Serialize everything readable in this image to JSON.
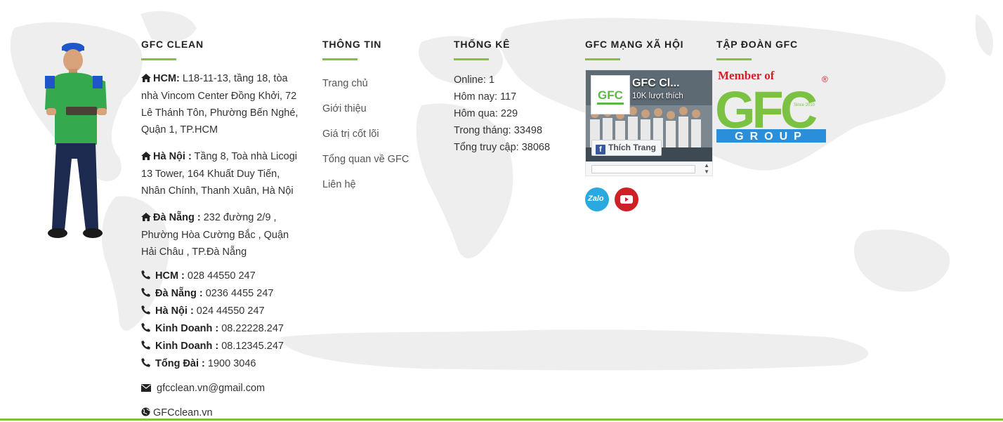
{
  "colors": {
    "accent": "#7fc241",
    "title": "#222222",
    "text": "#333333",
    "link": "#555555",
    "zalo": "#29a9e0",
    "youtube": "#cf2027"
  },
  "col1": {
    "title": "GFC CLEAN",
    "addresses": [
      {
        "icon": "home-icon",
        "label": "HCM:",
        "text": " L18-11-13, tầng 18, tòa nhà Vincom Center Đồng Khởi, 72 Lê Thánh Tôn, Phường Bến Nghé, Quận 1, TP.HCM"
      },
      {
        "icon": "home-icon",
        "label": "Hà Nội :",
        "text": " Tầng 8, Toà nhà Licogi 13 Tower, 164 Khuất Duy Tiến, Nhân Chính, Thanh Xuân, Hà Nội"
      },
      {
        "icon": "home-icon",
        "label": "Đà Nẵng :",
        "text": " 232 đường 2/9 , Phường Hòa Cường Bắc , Quận Hải Châu , TP.Đà Nẵng"
      }
    ],
    "phones": [
      {
        "icon": "phone-icon",
        "label": "HCM :",
        "value": " 028 44550 247"
      },
      {
        "icon": "phone-icon",
        "label": "Đà Nẵng :",
        "value": " 0236 4455 247"
      },
      {
        "icon": "phone-icon",
        "label": "Hà Nội :",
        "value": " 024 44550 247"
      },
      {
        "icon": "phone-icon",
        "label": "Kinh Doanh :",
        "value": " 08.22228.247"
      },
      {
        "icon": "phone-icon",
        "label": "Kinh Doanh :",
        "value": " 08.12345.247"
      },
      {
        "icon": "phone-icon",
        "label": "Tổng Đài :",
        "value": " 1900 3046"
      }
    ],
    "email": {
      "icon": "envelope-icon",
      "value": "gfcclean.vn@gmail.com"
    },
    "website": {
      "icon": "globe-icon",
      "value": "GFCclean.vn"
    }
  },
  "col2": {
    "title": "THÔNG TIN",
    "links": [
      "Trang chủ",
      "Giới thiệu",
      "Giá trị cốt lõi",
      "Tổng quan về GFC",
      "Liên hệ"
    ]
  },
  "col3": {
    "title": "THỐNG KÊ",
    "stats": [
      "Online: 1",
      "Hôm nay: 117",
      "Hôm qua: 229",
      "Trong tháng: 33498",
      "Tổng truy cập: 38068"
    ]
  },
  "col4": {
    "title": "GFC MẠNG XÃ HỘI",
    "facebook": {
      "page_name": "GFC Cl...",
      "likes": "10K lượt thích",
      "like_button": "Thích Trang",
      "logo_text": "GFC"
    },
    "social": [
      {
        "name": "zalo",
        "icon": "zalo-icon",
        "text": "Zalo"
      },
      {
        "name": "youtube",
        "icon": "youtube-icon"
      }
    ]
  },
  "col5": {
    "title": "TẬP ĐOÀN GFC",
    "logo": {
      "line1": "Member of",
      "brand": "GFC",
      "since": "Since 2010",
      "group": "GROUP",
      "mark": "®"
    }
  }
}
